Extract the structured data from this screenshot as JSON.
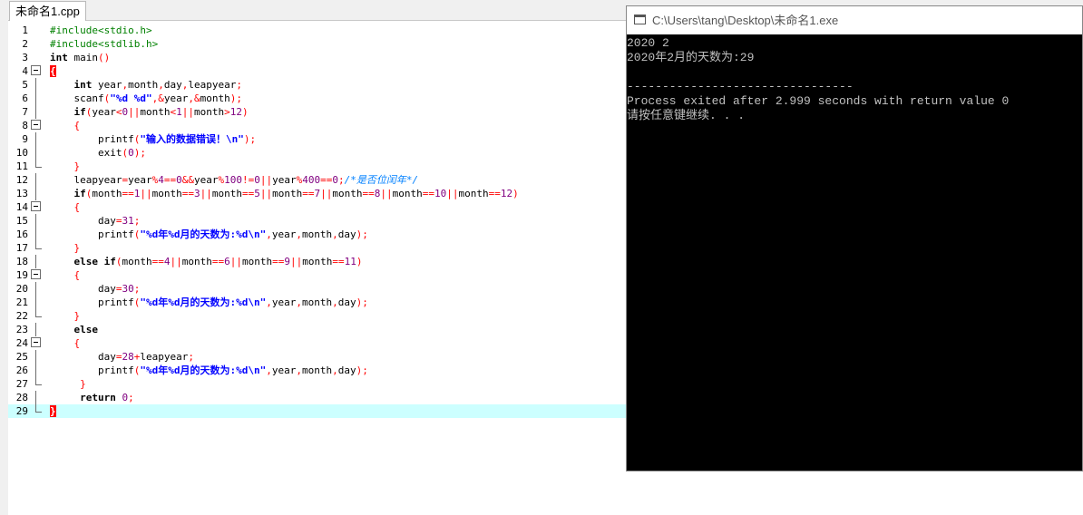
{
  "tab": {
    "label": "未命名1.cpp"
  },
  "code": {
    "line_numbers": [
      "1",
      "2",
      "3",
      "4",
      "5",
      "6",
      "7",
      "8",
      "9",
      "10",
      "11",
      "12",
      "13",
      "14",
      "15",
      "16",
      "17",
      "18",
      "19",
      "20",
      "21",
      "22",
      "23",
      "24",
      "25",
      "26",
      "27",
      "28",
      "29"
    ],
    "current_line": 29
  },
  "console": {
    "title": "C:\\Users\\tang\\Desktop\\未命名1.exe",
    "lines": [
      "2020 2",
      "2020年2月的天数为:29",
      "",
      "--------------------------------",
      "Process exited after 2.999 seconds with return value 0",
      "请按任意键继续. . ."
    ]
  }
}
